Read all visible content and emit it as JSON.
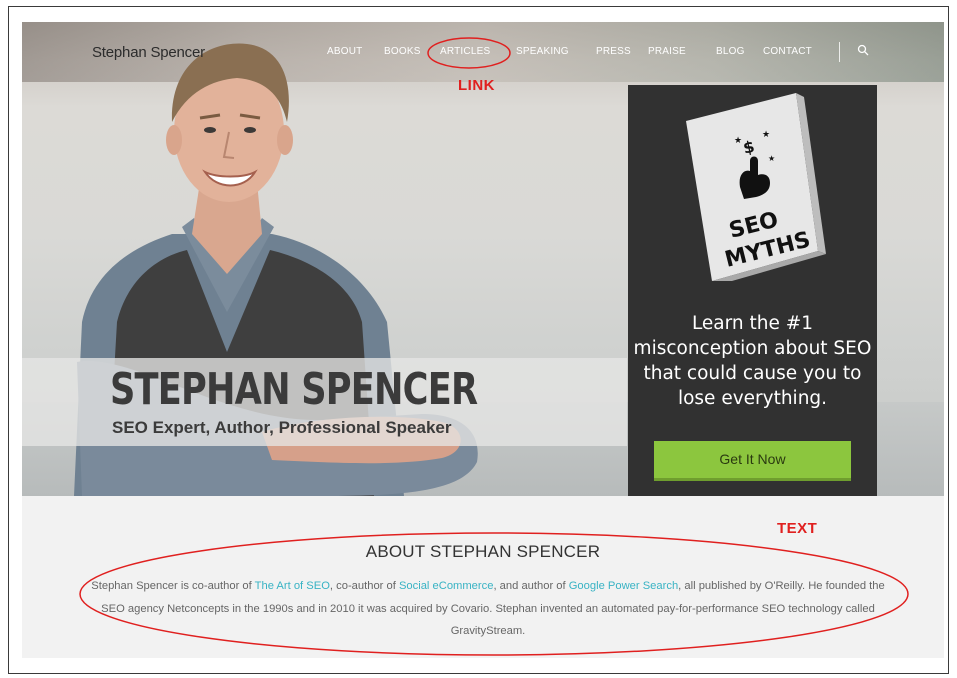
{
  "site": {
    "logo": "Stephan Spencer",
    "nav": [
      "ABOUT",
      "BOOKS",
      "ARTICLES",
      "SPEAKING",
      "PRESS",
      "PRAISE",
      "BLOG",
      "CONTACT"
    ]
  },
  "annotations": {
    "link_label": "LINK",
    "text_label": "TEXT",
    "color": "#e0201f"
  },
  "hero": {
    "title": "STEPHAN SPENCER",
    "subtitle": "SEO Expert, Author, Professional Speaker"
  },
  "ad": {
    "book_lines": [
      "SEO",
      "MYTHS"
    ],
    "book_symbol": "$",
    "text": "Learn the #1 misconception about SEO that could cause you to lose everything.",
    "button": "Get It Now",
    "button_color": "#8cc63e"
  },
  "about": {
    "title": "ABOUT STEPHAN SPENCER",
    "p1": "Stephan Spencer is co-author of ",
    "link1": "The Art of SEO",
    "p2": ", co-author of ",
    "link2": "Social eCommerce",
    "p3": ", and author of ",
    "link3": "Google Power Search",
    "p4": ", all published by O'Reilly. He founded the SEO agency Netconcepts in the 1990s and in 2010 it was acquired by Covario. Stephan invented an automated pay-for-performance SEO technology called GravityStream.",
    "link_color": "#39b3c4"
  }
}
